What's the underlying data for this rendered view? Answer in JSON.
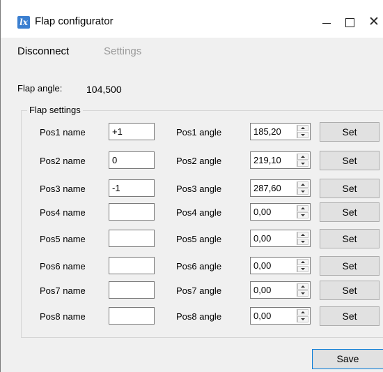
{
  "window": {
    "title": "Flap configurator",
    "icon": "lx-app-icon",
    "minimize_glyph": "",
    "close_glyph": "✕"
  },
  "menu": {
    "disconnect": "Disconnect",
    "settings": "Settings"
  },
  "readout": {
    "label": "Flap angle:",
    "value": "104,500"
  },
  "group": {
    "title": "Flap settings"
  },
  "rows": [
    {
      "name_label": "Pos1 name",
      "name_value": "+1",
      "angle_label": "Pos1 angle",
      "angle_value": "185,20",
      "set_label": "Set"
    },
    {
      "name_label": "Pos2 name",
      "name_value": "0",
      "angle_label": "Pos2 angle",
      "angle_value": "219,10",
      "set_label": "Set"
    },
    {
      "name_label": "Pos3 name",
      "name_value": "-1",
      "angle_label": "Pos3 angle",
      "angle_value": "287,60",
      "set_label": "Set"
    },
    {
      "name_label": "Pos4 name",
      "name_value": "",
      "angle_label": "Pos4 angle",
      "angle_value": "0,00",
      "set_label": "Set"
    },
    {
      "name_label": "Pos5 name",
      "name_value": "",
      "angle_label": "Pos5 angle",
      "angle_value": "0,00",
      "set_label": "Set"
    },
    {
      "name_label": "Pos6 name",
      "name_value": "",
      "angle_label": "Pos6 angle",
      "angle_value": "0,00",
      "set_label": "Set"
    },
    {
      "name_label": "Pos7 name",
      "name_value": "",
      "angle_label": "Pos7 angle",
      "angle_value": "0,00",
      "set_label": "Set"
    },
    {
      "name_label": "Pos8 name",
      "name_value": "",
      "angle_label": "Pos8 angle",
      "angle_value": "0,00",
      "set_label": "Set"
    }
  ],
  "footer": {
    "save_label": "Save"
  },
  "colors": {
    "window_bg": "#f0f0f0",
    "titlebar_bg": "#ffffff",
    "disabled_text": "#9a9a9a",
    "button_bg": "#e1e1e1",
    "focus_border": "#0078d7",
    "app_icon": "#3b7fd0"
  }
}
